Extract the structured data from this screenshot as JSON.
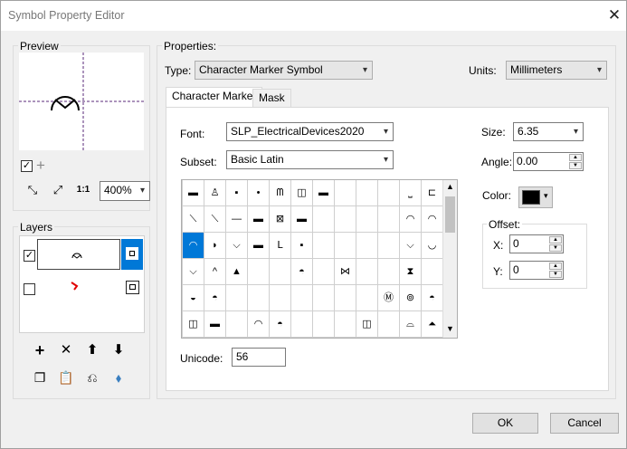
{
  "window": {
    "title": "Symbol Property Editor"
  },
  "preview": {
    "legend": "Preview",
    "zoom": "400%"
  },
  "layers": {
    "legend": "Layers"
  },
  "properties": {
    "legend": "Properties:",
    "type_label": "Type:",
    "type_value": "Character Marker Symbol",
    "units_label": "Units:",
    "units_value": "Millimeters",
    "tabs": [
      {
        "label": "Character Marker"
      },
      {
        "label": "Mask"
      }
    ],
    "font_label": "Font:",
    "font_value": "SLP_ElectricalDevices2020",
    "subset_label": "Subset:",
    "subset_value": "Basic Latin",
    "unicode_label": "Unicode:",
    "unicode_value": "56",
    "size_label": "Size:",
    "size_value": "6.35",
    "angle_label": "Angle:",
    "angle_value": "0.00",
    "color_label": "Color:",
    "color_swatch": "#000000",
    "offset_legend": "Offset:",
    "x_label": "X:",
    "x_value": "0",
    "y_label": "Y:",
    "y_value": "0"
  },
  "buttons": {
    "ok": "OK",
    "cancel": "Cancel"
  },
  "colors": {
    "selection": "#0078d7",
    "layer_symbol": "#e00000"
  }
}
